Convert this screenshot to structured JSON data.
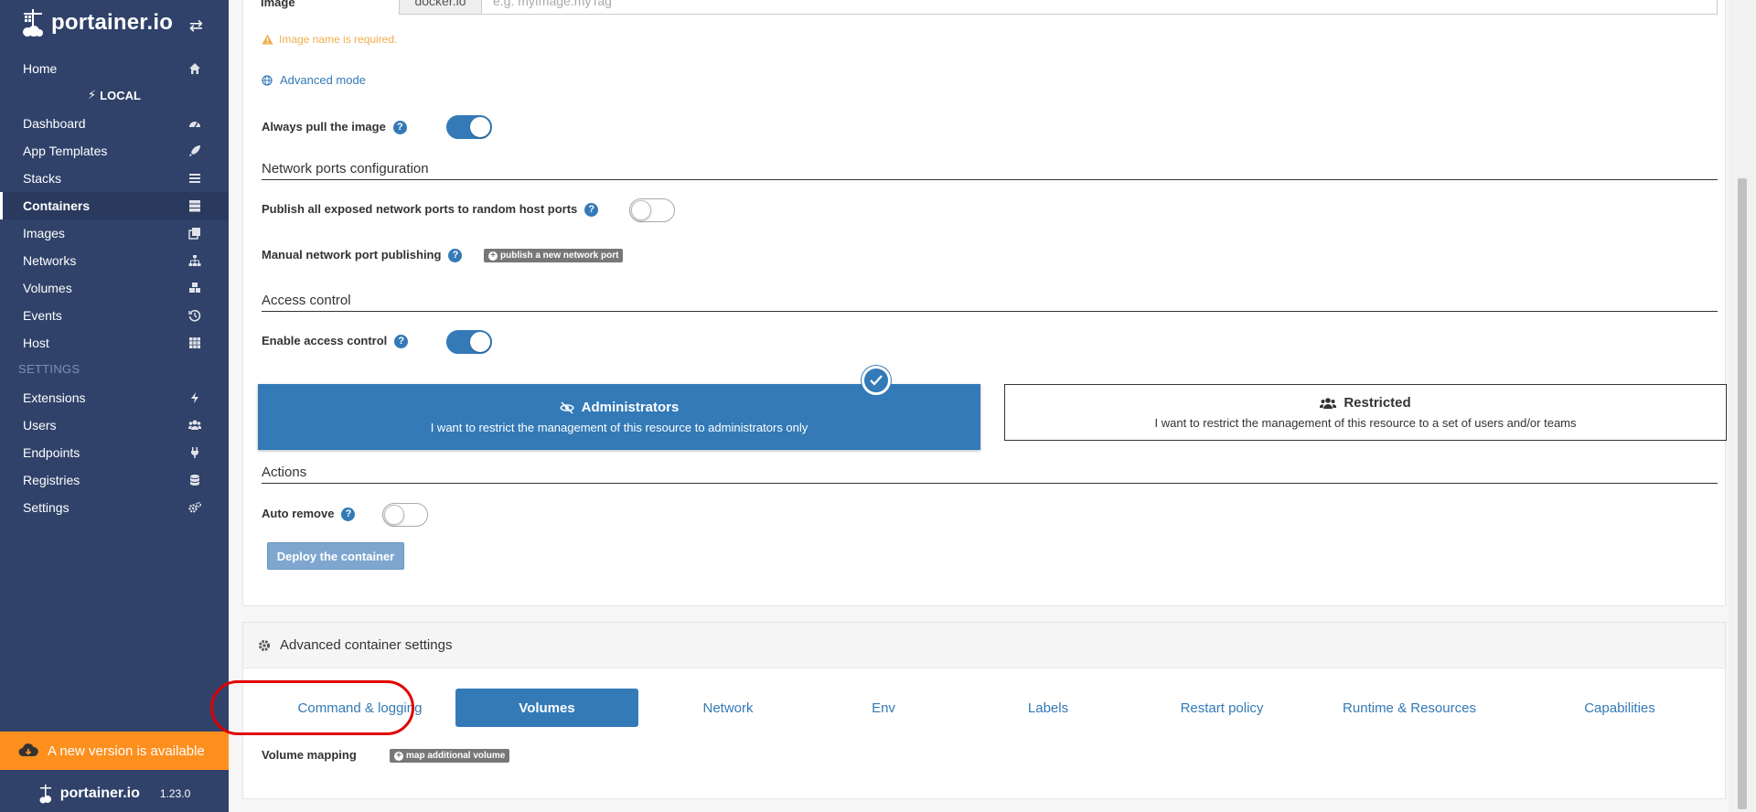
{
  "brand": {
    "name": "portainer.io",
    "version": "1.23.0"
  },
  "sidebar": {
    "home": "Home",
    "endpoint_heading": "LOCAL",
    "items": [
      {
        "label": "Dashboard",
        "icon": "dashboard-icon"
      },
      {
        "label": "App Templates",
        "icon": "rocket-icon"
      },
      {
        "label": "Stacks",
        "icon": "list-icon"
      },
      {
        "label": "Containers",
        "icon": "server-icon",
        "active": true
      },
      {
        "label": "Images",
        "icon": "clone-icon"
      },
      {
        "label": "Networks",
        "icon": "sitemap-icon"
      },
      {
        "label": "Volumes",
        "icon": "cubes-icon"
      },
      {
        "label": "Events",
        "icon": "history-icon"
      },
      {
        "label": "Host",
        "icon": "th-icon"
      }
    ],
    "settings_heading": "SETTINGS",
    "settings_items": [
      {
        "label": "Extensions",
        "icon": "bolt-icon"
      },
      {
        "label": "Users",
        "icon": "users-icon"
      },
      {
        "label": "Endpoints",
        "icon": "plug-icon"
      },
      {
        "label": "Registries",
        "icon": "database-icon"
      },
      {
        "label": "Settings",
        "icon": "cogs-icon"
      }
    ],
    "update_banner": "A new version is available"
  },
  "form": {
    "image_label": "Image",
    "registry_addon": "docker.io",
    "image_placeholder": "e.g. myImage:myTag",
    "image_warning": "Image name is required.",
    "advanced_mode": "Advanced mode",
    "always_pull_label": "Always pull the image",
    "always_pull": true,
    "network_section": "Network ports configuration",
    "publish_all_label": "Publish all exposed network ports to random host ports",
    "publish_all": false,
    "manual_publish_label": "Manual network port publishing",
    "publish_new_port": "publish a new network port",
    "access_section": "Access control",
    "enable_access_label": "Enable access control",
    "enable_access": true,
    "admin_title": "Administrators",
    "admin_desc": "I want to restrict the management of this resource to administrators only",
    "restricted_title": "Restricted",
    "restricted_desc": "I want to restrict the management of this resource to a set of users and/or teams",
    "actions_section": "Actions",
    "auto_remove_label": "Auto remove",
    "auto_remove": false,
    "deploy_button": "Deploy the container"
  },
  "advanced": {
    "title": "Advanced container settings",
    "tabs": [
      "Command & logging",
      "Volumes",
      "Network",
      "Env",
      "Labels",
      "Restart policy",
      "Runtime & Resources",
      "Capabilities"
    ],
    "active_tab": "Volumes",
    "volume_mapping_label": "Volume mapping",
    "map_volume_button": "map additional volume"
  },
  "colors": {
    "sidebar": "#30426a",
    "primary": "#337ab7",
    "warning": "#f0ad4e",
    "banner": "#fd8f1e",
    "highlight": "#e00000"
  }
}
